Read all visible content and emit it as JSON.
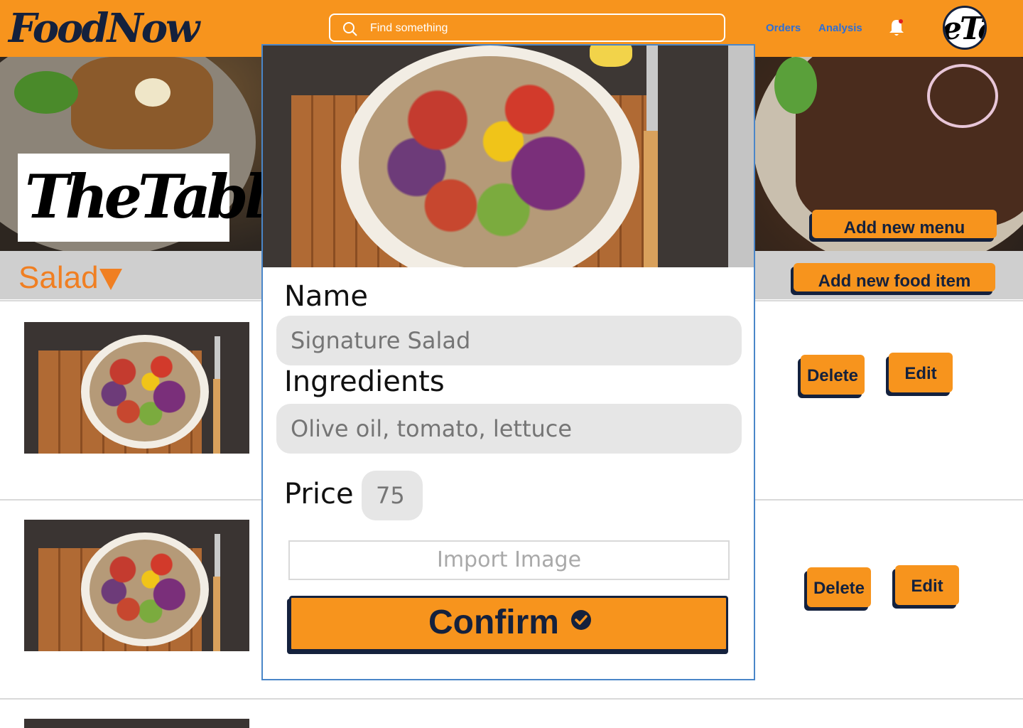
{
  "app": {
    "brand": "FoodNow",
    "accent_color": "#F7941D",
    "dark_color": "#14213D"
  },
  "header": {
    "search_placeholder": "Find something",
    "nav": [
      "Orders",
      "Analysis"
    ],
    "notification_icon": "bell-icon",
    "avatar_text": "eTal"
  },
  "restaurant": {
    "logo_text": "TheTable"
  },
  "actions": {
    "add_menu": "Add new menu",
    "add_food_item": "Add new food item"
  },
  "category": {
    "label": "Salad",
    "icon": "triangle-down-icon"
  },
  "items": [
    {
      "delete_label": "Delete",
      "edit_label": "Edit"
    },
    {
      "delete_label": "Delete",
      "edit_label": "Edit"
    }
  ],
  "modal": {
    "name_label": "Name",
    "name_placeholder": "Signature Salad",
    "ingredients_label": "Ingredients",
    "ingredients_placeholder": "Olive oil, tomato, lettuce",
    "price_label": "Price",
    "price_placeholder": "75",
    "import_label": "Import Image",
    "confirm_label": "Confirm",
    "confirm_icon": "check-circle-icon"
  }
}
